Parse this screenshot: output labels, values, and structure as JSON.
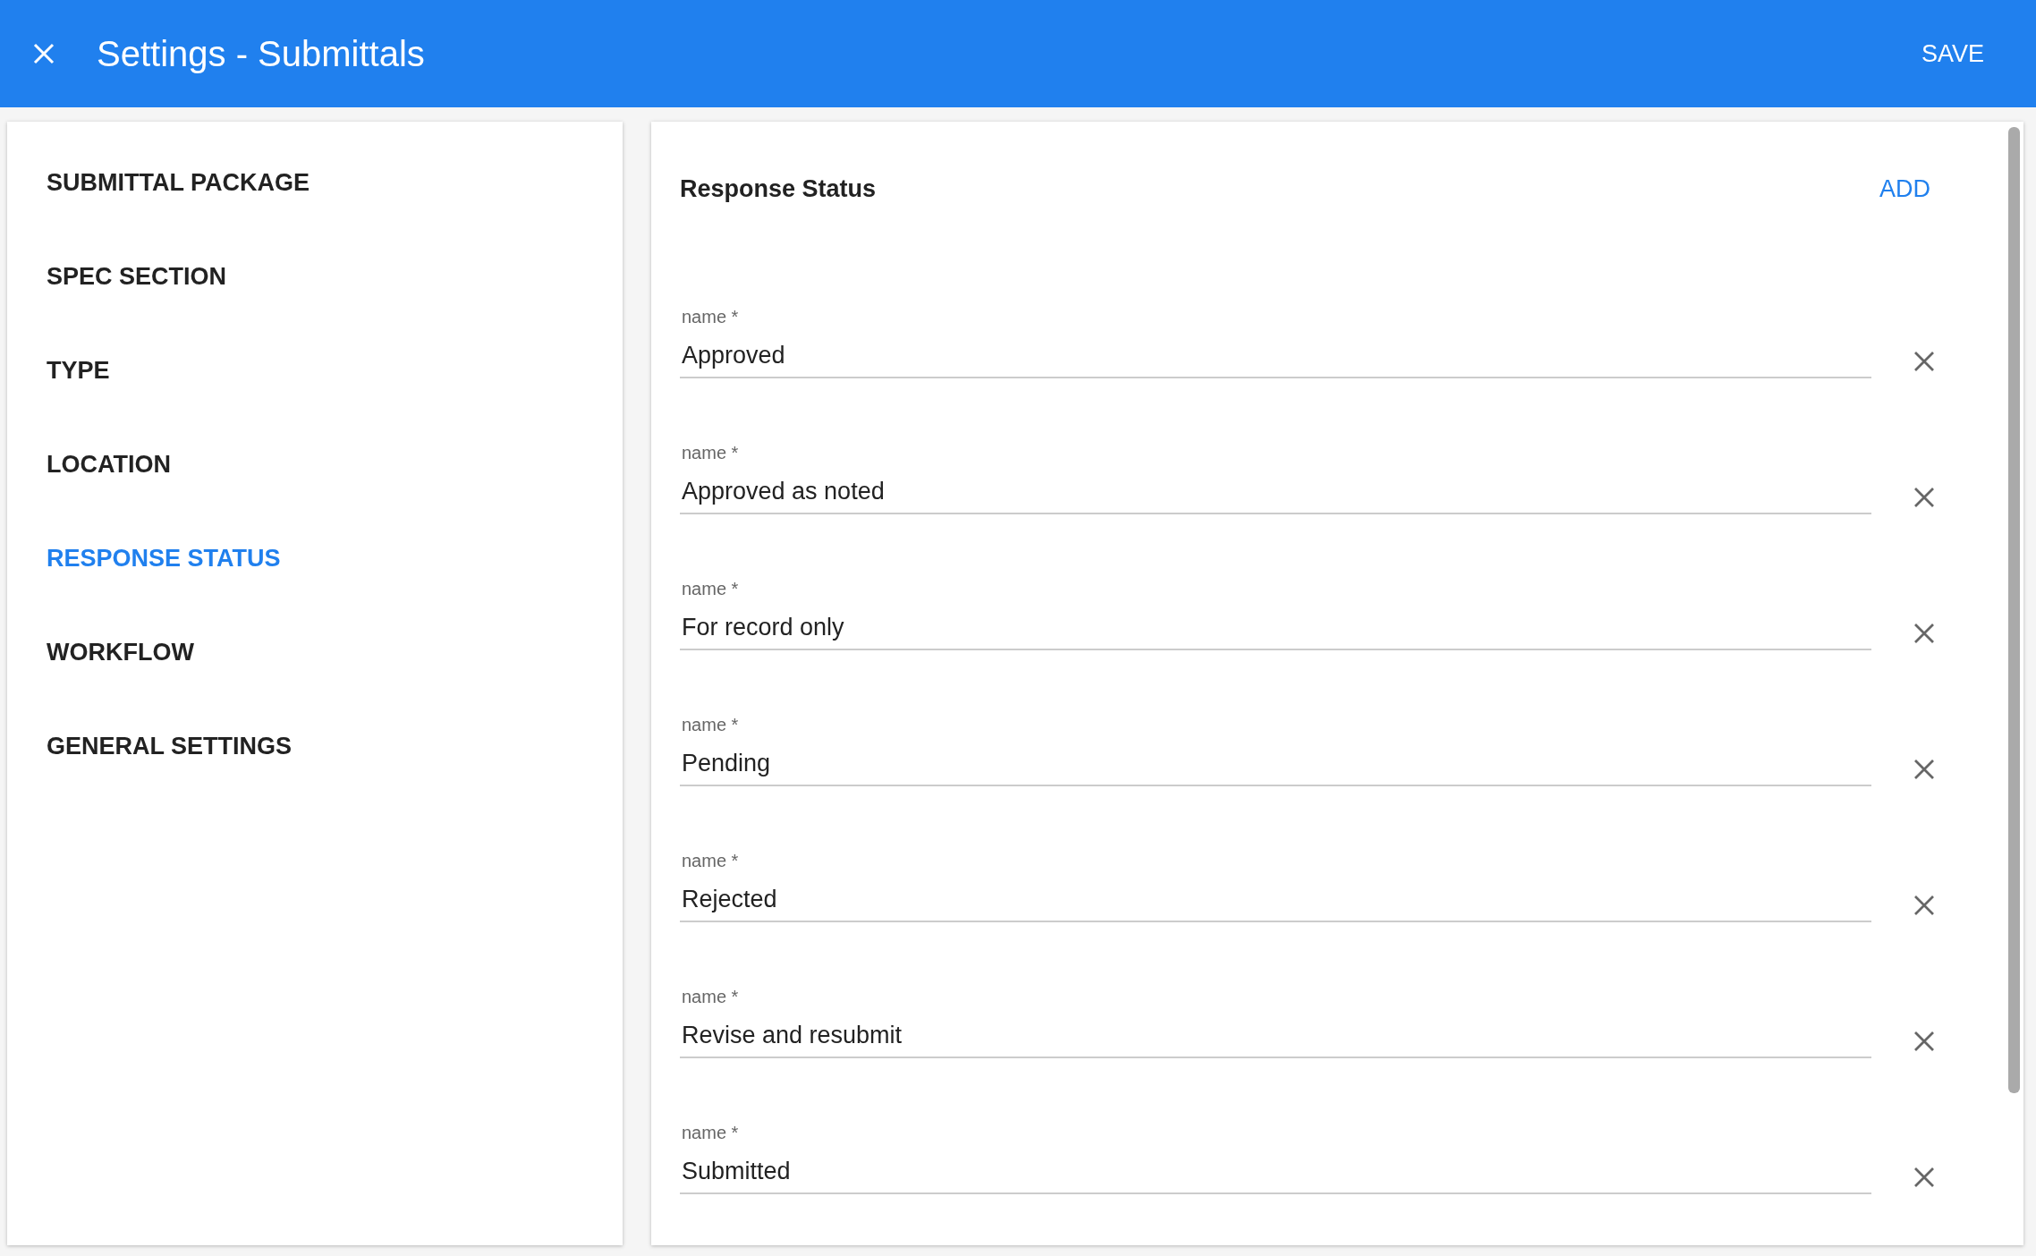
{
  "header": {
    "title": "Settings - Submittals",
    "save": "SAVE"
  },
  "sidebar": {
    "items": [
      {
        "label": "SUBMITTAL PACKAGE",
        "selected": false
      },
      {
        "label": "SPEC SECTION",
        "selected": false
      },
      {
        "label": "TYPE",
        "selected": false
      },
      {
        "label": "LOCATION",
        "selected": false
      },
      {
        "label": "RESPONSE STATUS",
        "selected": true
      },
      {
        "label": "WORKFLOW",
        "selected": false
      },
      {
        "label": "GENERAL SETTINGS",
        "selected": false
      }
    ]
  },
  "panel": {
    "title": "Response Status",
    "add": "ADD",
    "fields": [
      {
        "label": "name *",
        "value": "Approved"
      },
      {
        "label": "name *",
        "value": "Approved as noted"
      },
      {
        "label": "name *",
        "value": "For record only"
      },
      {
        "label": "name *",
        "value": "Pending"
      },
      {
        "label": "name *",
        "value": "Rejected"
      },
      {
        "label": "name *",
        "value": "Revise and resubmit"
      },
      {
        "label": "name *",
        "value": "Submitted"
      }
    ]
  }
}
